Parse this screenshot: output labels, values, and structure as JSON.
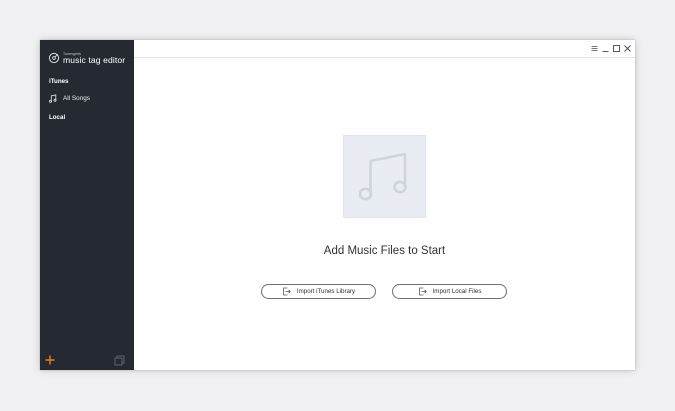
{
  "app": {
    "brand_prefix": "Tunesgeek",
    "brand_name": "music tag editor"
  },
  "sidebar": {
    "sections": [
      {
        "label": "iTunes"
      },
      {
        "label": "Local"
      }
    ],
    "items": [
      {
        "label": "All Songs",
        "icon": "music-note-icon"
      }
    ],
    "footer": {
      "add_icon": "plus-icon",
      "add_color": "#f07d1e",
      "copy_icon": "copy-icon"
    }
  },
  "titlebar": {
    "buttons": [
      "menu-icon",
      "minimize-icon",
      "maximize-icon",
      "close-icon"
    ]
  },
  "main": {
    "empty_icon": "music-note-icon",
    "headline": "Add Music Files to Start",
    "buttons": [
      {
        "label": "Import iTunes Library",
        "icon": "import-icon"
      },
      {
        "label": "Import Local Files",
        "icon": "import-icon"
      }
    ]
  },
  "colors": {
    "sidebar_bg": "#252a32",
    "accent": "#f07d1e",
    "placeholder_bg": "#e9ecf3"
  }
}
